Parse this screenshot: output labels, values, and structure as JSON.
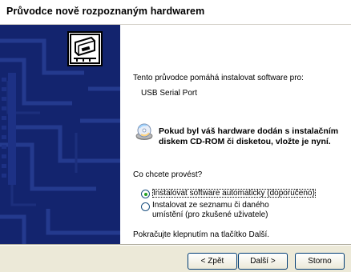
{
  "window": {
    "title": "Průvodce nově rozpoznaným hardwarem"
  },
  "content": {
    "intro": "Tento průvodce pomáhá instalovat software pro:",
    "device": "USB Serial Port",
    "cd_notice": "Pokud byl váš hardware dodán s instalačním diskem CD-ROM či disketou, vložte je nyní.",
    "question": "Co chcete provést?",
    "options": [
      {
        "label": "Instalovat software automaticky (doporučeno)",
        "selected": true
      },
      {
        "label_line1": "Instalovat ze seznamu či daného",
        "label_line2": "umístění (pro zkušené uživatele)",
        "selected": false
      }
    ],
    "continue": "Pokračujte klepnutím na tlačítko Další."
  },
  "buttons": {
    "back": "< Zpět",
    "next": "Další >",
    "cancel": "Storno"
  },
  "colors": {
    "banner": "#13246e",
    "accent": "#21a121"
  },
  "icons": [
    "hardware-wizard-icon",
    "cd-rom-icon"
  ]
}
